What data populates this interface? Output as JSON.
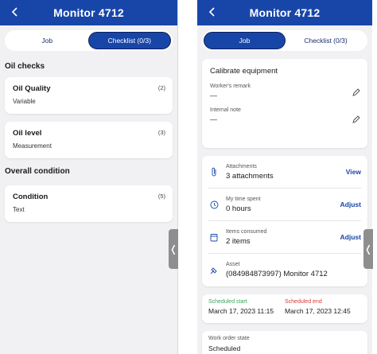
{
  "colors": {
    "primary": "#1846a8",
    "scheduled_start": "#3aa55c",
    "scheduled_end": "#d83a3a"
  },
  "left": {
    "header": {
      "title": "Monitor 4712"
    },
    "tabs": [
      {
        "label": "Job"
      },
      {
        "label": "Checklist (0/3)"
      }
    ],
    "sections": [
      {
        "title": "Oil checks",
        "items": [
          {
            "name": "Oil Quality",
            "type": "Variable",
            "badge": "(2)"
          },
          {
            "name": "Oil level",
            "type": "Measurement",
            "badge": "(3)"
          }
        ]
      },
      {
        "title": "Overall condition",
        "items": [
          {
            "name": "Condition",
            "type": "Text",
            "badge": "(5)"
          }
        ]
      }
    ],
    "handle": "❬"
  },
  "right": {
    "header": {
      "title": "Monitor 4712"
    },
    "tabs": [
      {
        "label": "Job"
      },
      {
        "label": "Checklist (0/3)"
      }
    ],
    "task": {
      "title": "Calibrate equipment",
      "workers_remark_label": "Worker's remark",
      "workers_remark_value": "—",
      "internal_note_label": "Internal note",
      "internal_note_value": "—"
    },
    "info": [
      {
        "icon": "paperclip-icon",
        "label": "Attachments",
        "value": "3 attachments",
        "action": "View"
      },
      {
        "icon": "clock-icon",
        "label": "My time spent",
        "value": "0 hours",
        "action": "Adjust"
      },
      {
        "icon": "box-icon",
        "label": "Items consumed",
        "value": "2 items",
        "action": "Adjust"
      },
      {
        "icon": "asset-icon",
        "label": "Asset",
        "value": "(084984873997) Monitor 4712",
        "action": ""
      }
    ],
    "schedule": {
      "start_label": "Scheduled start",
      "start_value": "March 17, 2023 11:15",
      "end_label": "Scheduled end",
      "end_value": "March 17, 2023 12:45"
    },
    "state": {
      "label": "Work order state",
      "value": "Scheduled"
    },
    "handle": "❬"
  }
}
